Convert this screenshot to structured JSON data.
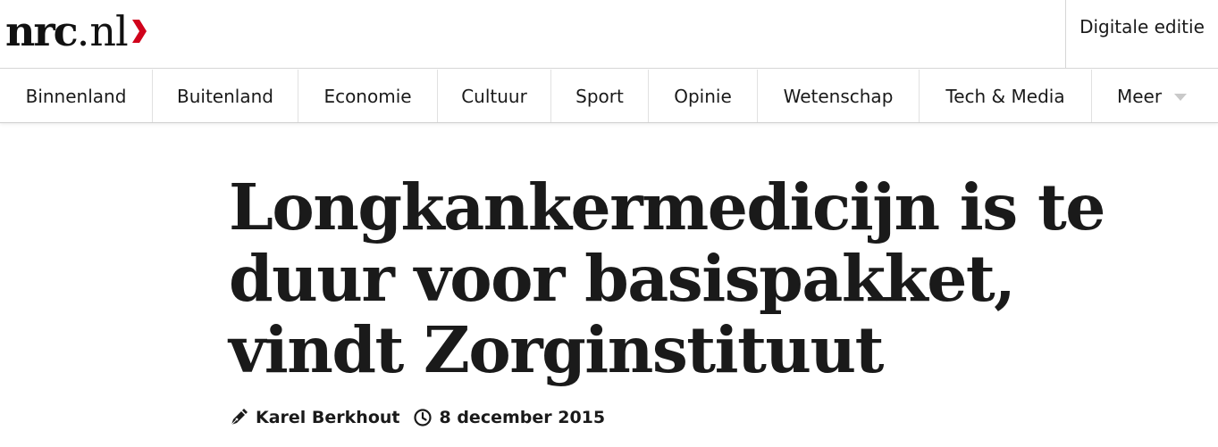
{
  "header": {
    "logo_main": "nrc",
    "logo_dot": ".",
    "logo_tld": "nl",
    "logo_accent_color": "#d0021b",
    "digitale_editie_label": "Digitale editie"
  },
  "nav": {
    "items": [
      {
        "label": "Binnenland"
      },
      {
        "label": "Buitenland"
      },
      {
        "label": "Economie"
      },
      {
        "label": "Cultuur"
      },
      {
        "label": "Sport"
      },
      {
        "label": "Opinie"
      },
      {
        "label": "Wetenschap"
      },
      {
        "label": "Tech & Media"
      },
      {
        "label": "Meer"
      }
    ]
  },
  "article": {
    "title": "Longkankermedicijn is te duur voor basispakket, vindt Zorginstituut",
    "author": "Karel Berkhout",
    "author_icon": "pen-icon",
    "date": "8 december 2015",
    "date_icon": "clock-icon"
  }
}
